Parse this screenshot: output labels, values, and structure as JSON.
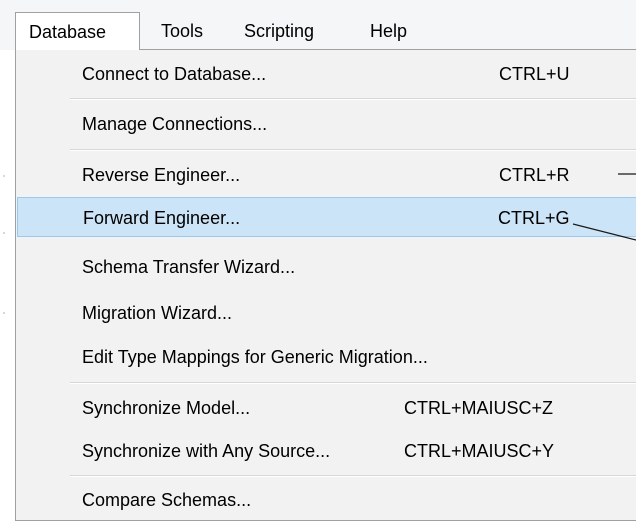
{
  "menubar": {
    "items": [
      {
        "label": "Database",
        "active": true
      },
      {
        "label": "Tools"
      },
      {
        "label": "Scripting"
      },
      {
        "label": "Help"
      }
    ]
  },
  "dropdown": {
    "items": [
      {
        "label": "Connect to Database...",
        "shortcut": "CTRL+U"
      },
      {
        "label": "Manage Connections...",
        "shortcut": ""
      },
      {
        "label": "Reverse Engineer...",
        "shortcut": "CTRL+R"
      },
      {
        "label": "Forward Engineer...",
        "shortcut": "CTRL+G",
        "highlighted": true
      },
      {
        "label": "Schema Transfer Wizard...",
        "shortcut": ""
      },
      {
        "label": "Migration Wizard...",
        "shortcut": ""
      },
      {
        "label": "Edit Type Mappings for Generic Migration...",
        "shortcut": ""
      },
      {
        "label": "Synchronize Model...",
        "shortcut": "CTRL+MAIUSC+Z"
      },
      {
        "label": "Synchronize with Any Source...",
        "shortcut": "CTRL+MAIUSC+Y"
      },
      {
        "label": "Compare Schemas...",
        "shortcut": ""
      }
    ]
  },
  "colors": {
    "highlight_bg": "#cce4f7",
    "highlight_border": "#99c9ef",
    "menu_bg": "#f2f2f2",
    "menubar_bg": "#f5f6f7"
  }
}
